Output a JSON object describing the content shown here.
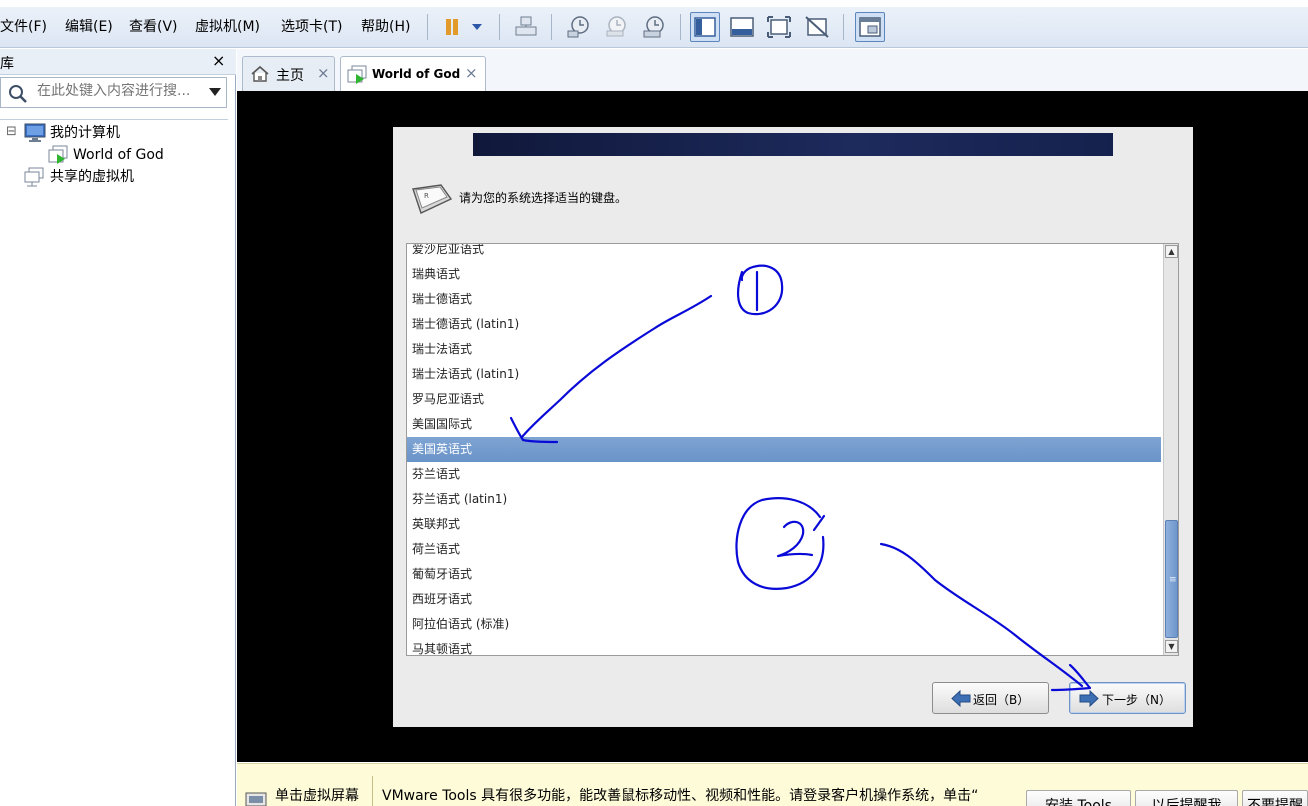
{
  "menubar": {
    "items": [
      {
        "label": "文件(F)"
      },
      {
        "label": "编辑(E)"
      },
      {
        "label": "查看(V)"
      },
      {
        "label": "虚拟机(M)"
      },
      {
        "label": "选项卡(T)"
      },
      {
        "label": "帮助(H)"
      }
    ],
    "toolbar_icons": [
      "pause-icon",
      "dropdown-arrow-icon",
      "send-ctrl-alt-del-icon",
      "snapshot-take-icon",
      "snapshot-revert-icon",
      "snapshot-manager-icon",
      "show-library-icon",
      "thumbnail-bar-icon",
      "full-screen-icon",
      "unity-icon",
      "console-view-icon"
    ],
    "accent_color": "#e29a2a"
  },
  "library": {
    "title": "库",
    "close_glyph": "×",
    "search_placeholder": "在此处键入内容进行搜...",
    "tree": [
      {
        "label": "我的计算机",
        "icon": "computer-icon",
        "expander": "⊟"
      },
      {
        "label": "World of God",
        "icon": "vm-running-icon"
      },
      {
        "label": "共享的虚拟机",
        "icon": "shared-vm-icon"
      }
    ]
  },
  "tabs": [
    {
      "label": "主页",
      "icon": "home-icon",
      "close": "×"
    },
    {
      "label": "World of God",
      "icon": "vm-running-icon",
      "close": "×"
    }
  ],
  "installer": {
    "prompt": "请为您的系统选择适当的键盘。",
    "keyboards": [
      "爱沙尼亚语式",
      "瑞典语式",
      "瑞士德语式",
      "瑞士德语式 (latin1)",
      "瑞士法语式",
      "瑞士法语式 (latin1)",
      "罗马尼亚语式",
      "美国国际式",
      "美国英语式",
      "芬兰语式",
      "芬兰语式 (latin1)",
      "英联邦式",
      "荷兰语式",
      "葡萄牙语式",
      "西班牙语式",
      "阿拉伯语式 (标准)",
      "马其顿语式"
    ],
    "selected_keyboard": "美国英语式",
    "back_button": "返回（B）",
    "next_button": "下一步（N）",
    "scroll_up_glyph": "▲",
    "scroll_down_glyph": "▼",
    "scroll_grip_glyph": "≡",
    "selection_color": "#6a93c8"
  },
  "notification": {
    "click_hint": "单击虚拟屏幕",
    "message": "VMware Tools 具有很多功能，能改善鼠标移动性、视频和性能。请登录客户机操作系统，单击“",
    "buttons": [
      "安装 Tools",
      "以后提醒我",
      "不要提醒"
    ]
  },
  "annotations": {
    "ink_color": "#0a0ad8",
    "marks": [
      "①",
      "②"
    ]
  }
}
